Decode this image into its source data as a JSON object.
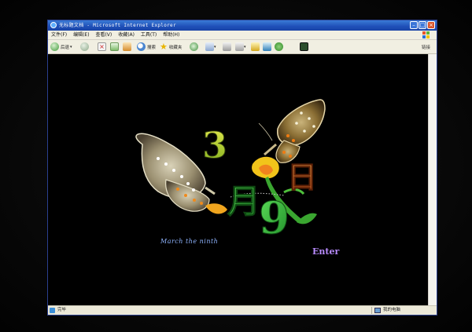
{
  "window": {
    "title": "无标题文档 - Microsoft Internet Explorer",
    "menu": [
      "文件(F)",
      "编辑(E)",
      "查看(V)",
      "收藏(A)",
      "工具(T)",
      "帮助(H)"
    ]
  },
  "toolbar": {
    "back_label": "后退",
    "search_label": "搜索",
    "favorites_label": "收藏夹",
    "links_label": "链接"
  },
  "page": {
    "number_3": "3",
    "char_month": "月",
    "number_9": "9",
    "char_day": "日",
    "subtitle": "March the ninth",
    "enter_link": "Enter"
  },
  "status": {
    "left_text": "完毕",
    "right_text": "我的电脑"
  },
  "colors": {
    "title_bar": "#2456c2",
    "page_background": "#000000",
    "enter_link": "#b98cff",
    "subtitle": "#8fb4ff"
  }
}
